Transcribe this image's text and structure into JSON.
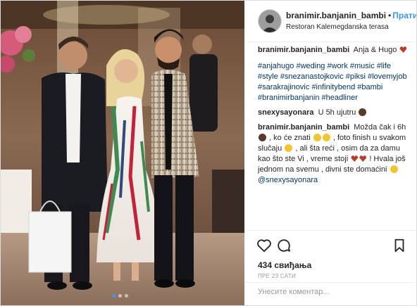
{
  "post": {
    "username": "branimir.banjanin_bambi",
    "follow_label": "Прати",
    "location": "Restoran Kalemegdanska terasa"
  },
  "comments": [
    {
      "user": "branimir.banjanin_bambi",
      "text": "Anja & Hugo",
      "emojis": [
        "red-heart"
      ],
      "hashtags": [
        "#anjahugo",
        "#weding",
        "#work",
        "#music",
        "#life",
        "#style",
        "#snezanastojkovic",
        "#piksi",
        "#lovemyjob",
        "#sarakrajinovic",
        "#infinitybend",
        "#bambi",
        "#branimirbanjanin",
        "#headliner"
      ]
    },
    {
      "user": "snexysayonara",
      "text": "U 5h ujutru",
      "emojis": [
        "woman-raising-hand"
      ]
    },
    {
      "user": "branimir.banjanin_bambi",
      "parts": [
        "Možda čak i 6h",
        ", ko će znati",
        ", foto finish u svakom slučaju",
        ", ali šta reći , osim da za damu kao što ste Vi , vreme stoji",
        "! Hvala još jednom na svemu , divni ste domaćini",
        ""
      ],
      "mention": "@snexysayonara"
    }
  ],
  "likes": "434 свиђања",
  "time": "ПРЕ 23 САТИ",
  "comment_placeholder": "Унесите коментар...",
  "colors": {
    "link": "#3897f0",
    "hashtag": "#003569",
    "heart": "#c0392b"
  },
  "icons": [
    "heart-outline-icon",
    "comment-bubble-icon",
    "bookmark-icon"
  ]
}
